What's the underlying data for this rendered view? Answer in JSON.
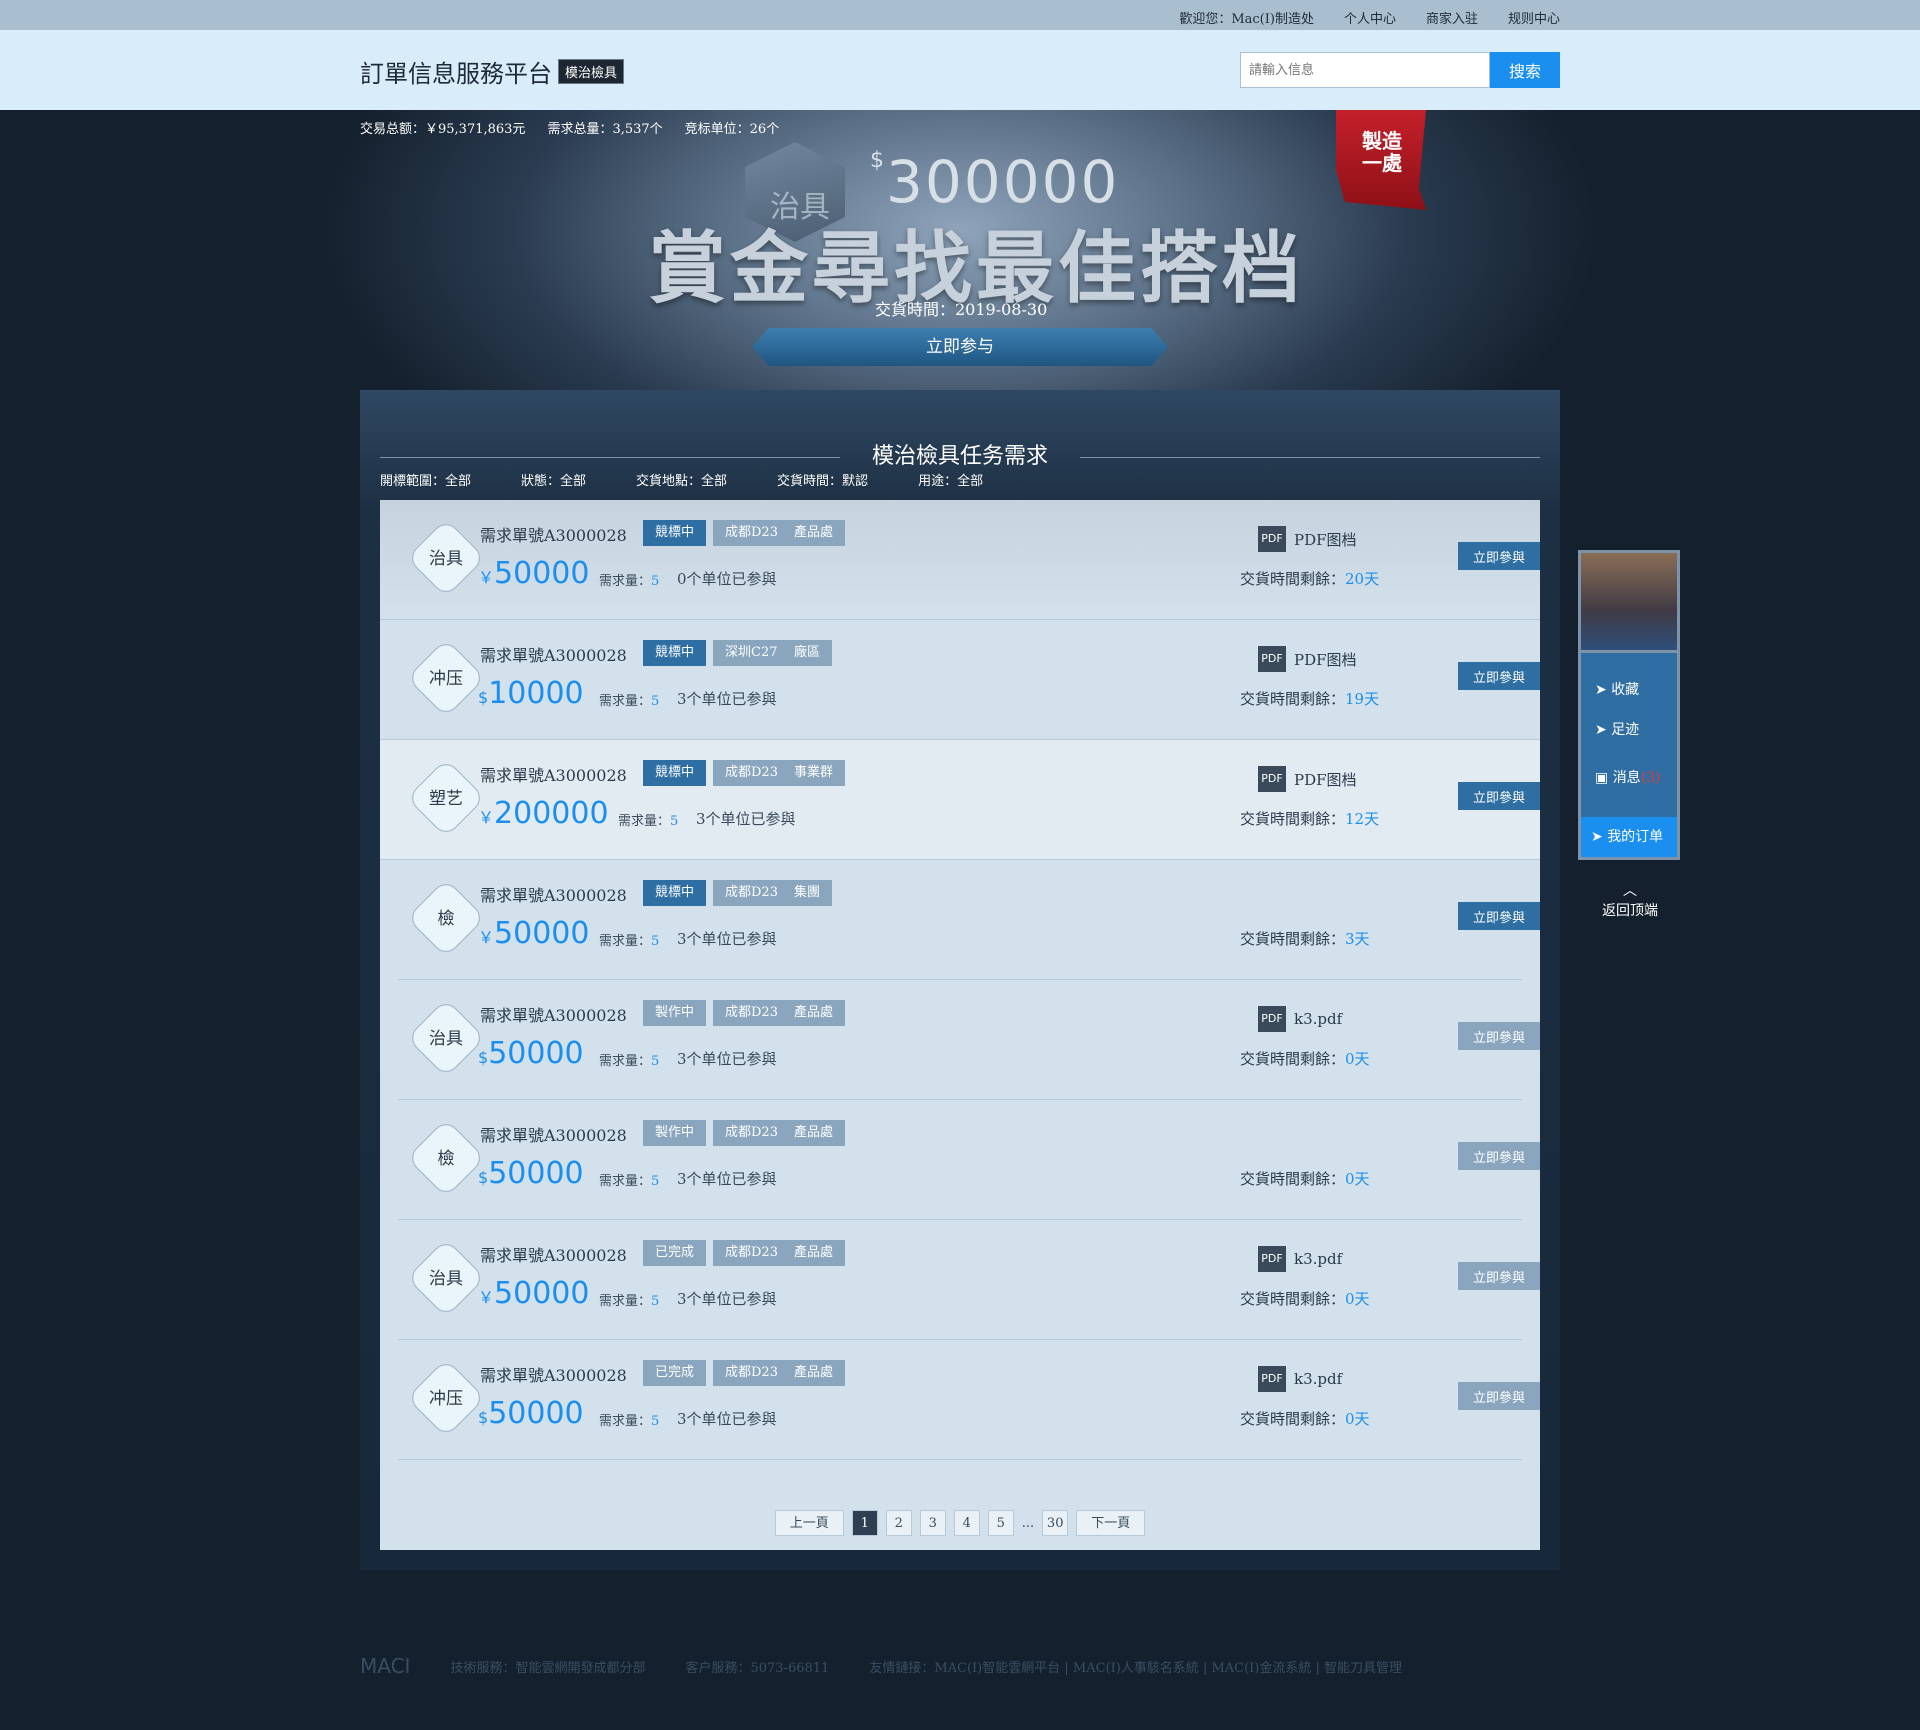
{
  "topbar": {
    "welcome": "歡迎您：Mac(I)制造处",
    "links": [
      "个人中心",
      "商家入驻",
      "规则中心"
    ]
  },
  "header": {
    "title": "訂單信息服務平台",
    "badge": "模治檢具",
    "search_placeholder": "請輸入信息",
    "search_button": "搜索"
  },
  "hero": {
    "stats": [
      "交易总额：￥95,371,863元",
      "需求总量：3,537个",
      "竞标单位：26个"
    ],
    "hex_label": "治具",
    "amount_symbol": "$",
    "amount": "300000",
    "headline": "賞金尋找最佳搭档",
    "date": "交貨時間：2019-08-30",
    "cta": "立即参与",
    "ribbon": "製造一處"
  },
  "panel": {
    "title": "模治檢具任务需求",
    "filters": [
      "開標範圍：全部",
      "狀態：全部",
      "交貨地點：全部",
      "交貨時間：默認",
      "用途：全部"
    ]
  },
  "orders": [
    {
      "cat": "治具",
      "id": "需求單號A3000028",
      "status": "競標中",
      "loc": "成都D23",
      "dept": "產品處",
      "cur": "￥",
      "price": "50000",
      "qty_label": "需求量：",
      "qty": "5",
      "joined": "0个单位已参與",
      "file": "PDF图档",
      "remain_label": "交貨時間剩餘：",
      "remain": "20天",
      "btn": "立即參與"
    },
    {
      "cat": "冲压",
      "id": "需求單號A3000028",
      "status": "競標中",
      "loc": "深圳C27",
      "dept": "廠區",
      "cur": "$",
      "price": "10000",
      "qty_label": "需求量：",
      "qty": "5",
      "joined": "3个单位已参與",
      "file": "PDF图档",
      "remain_label": "交貨時間剩餘：",
      "remain": "19天",
      "btn": "立即參與"
    },
    {
      "cat": "塑艺",
      "id": "需求單號A3000028",
      "status": "競標中",
      "loc": "成都D23",
      "dept": "事業群",
      "cur": "￥",
      "price": "200000",
      "qty_label": "需求量：",
      "qty": "5",
      "joined": "3个单位已参與",
      "file": "PDF图档",
      "remain_label": "交貨時間剩餘：",
      "remain": "12天",
      "btn": "立即參與"
    },
    {
      "cat": "檢",
      "id": "需求單號A3000028",
      "status": "競標中",
      "loc": "成都D23",
      "dept": "集團",
      "cur": "￥",
      "price": "50000",
      "qty_label": "需求量：",
      "qty": "5",
      "joined": "3个单位已参與",
      "file": "",
      "remain_label": "交貨時間剩餘：",
      "remain": "3天",
      "btn": "立即參與"
    },
    {
      "cat": "治具",
      "id": "需求單號A3000028",
      "status": "製作中",
      "loc": "成都D23",
      "dept": "產品處",
      "cur": "$",
      "price": "50000",
      "qty_label": "需求量：",
      "qty": "5",
      "joined": "3个单位已参與",
      "file": "k3.pdf",
      "remain_label": "交貨時間剩餘：",
      "remain": "0天",
      "btn": "立即參與"
    },
    {
      "cat": "檢",
      "id": "需求單號A3000028",
      "status": "製作中",
      "loc": "成都D23",
      "dept": "產品處",
      "cur": "$",
      "price": "50000",
      "qty_label": "需求量：",
      "qty": "5",
      "joined": "3个单位已参與",
      "file": "",
      "remain_label": "交貨時間剩餘：",
      "remain": "0天",
      "btn": "立即參與"
    },
    {
      "cat": "治具",
      "id": "需求單號A3000028",
      "status": "已完成",
      "loc": "成都D23",
      "dept": "產品處",
      "cur": "￥",
      "price": "50000",
      "qty_label": "需求量：",
      "qty": "5",
      "joined": "3个单位已参與",
      "file": "k3.pdf",
      "remain_label": "交貨時間剩餘：",
      "remain": "0天",
      "btn": "立即參與"
    },
    {
      "cat": "冲压",
      "id": "需求單號A3000028",
      "status": "已完成",
      "loc": "成都D23",
      "dept": "產品處",
      "cur": "$",
      "price": "50000",
      "qty_label": "需求量：",
      "qty": "5",
      "joined": "3个单位已参與",
      "file": "k3.pdf",
      "remain_label": "交貨時間剩餘：",
      "remain": "0天",
      "btn": "立即參與"
    }
  ],
  "pdf_icon": "PDF",
  "pager": {
    "prev": "上一頁",
    "pages": [
      "1",
      "2",
      "3",
      "4",
      "5"
    ],
    "ellipsis": "...",
    "last": "30",
    "next": "下一頁",
    "current": "1"
  },
  "side": {
    "items": [
      "收藏",
      "足迹"
    ],
    "messages": "消息",
    "messages_count": "(3)",
    "my_orders": "我的订单",
    "back_top": "返回顶端"
  },
  "footer": {
    "logo": "MACI",
    "tech": "技術服務：智能雲網開發成都分部",
    "service": "客户服務：5073-66811",
    "links": "友情鏈接：MAC(I)智能雲網平台 | MAC(I)人事駭名系統 | MAC(I)金流系統 | 智能刀具管理"
  },
  "colors": {
    "accent": "#1b8ff0",
    "tag_active": "#2f6ea3",
    "tag_default": "#8aa6bf",
    "page_bg": "#14202d"
  }
}
